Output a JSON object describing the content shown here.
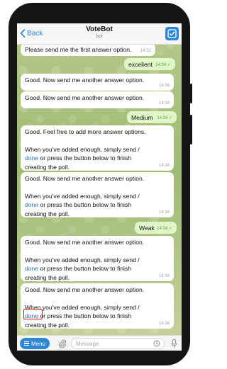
{
  "header": {
    "back_label": "Back",
    "title": "VoteBot",
    "subtitle": "bot"
  },
  "messages": [
    {
      "id": "m1",
      "direction": "in",
      "text": "Please send me the first answer option.",
      "time": "14:33"
    },
    {
      "id": "m2",
      "direction": "out",
      "text": "excellent",
      "time": "14:34"
    },
    {
      "id": "m3",
      "direction": "in",
      "text": "Good. Now send me another answer option.",
      "time": "14:34"
    },
    {
      "id": "m4",
      "direction": "in",
      "text": "Good. Now send me another answer option.",
      "time": "14:34"
    },
    {
      "id": "m5",
      "direction": "out",
      "text": "Medium",
      "time": "14:34"
    },
    {
      "id": "m6",
      "direction": "in",
      "line1": "Good. Feel free to add more answer options.",
      "line2": "When you've added enough, simply send /",
      "link": "done",
      "line3_rest": " or press the button below to finish",
      "line4": "creating the poll.",
      "time": "14:34"
    },
    {
      "id": "m7",
      "direction": "in",
      "line1": "Good. Now send me another answer option.",
      "line2": "When you've added enough, simply send /",
      "link": "done",
      "line3_rest": " or press the button below to finish",
      "line4": "creating the poll.",
      "time": "14:34"
    },
    {
      "id": "m8",
      "direction": "out",
      "text": "Weak",
      "time": "14:34"
    },
    {
      "id": "m9",
      "direction": "in",
      "line1": "Good. Now send me another answer option.",
      "line2": "When you've added enough, simply send /",
      "link": "done",
      "line3_rest": " or press the button below to finish",
      "line4": "creating the poll.",
      "time": "14:34"
    },
    {
      "id": "m10",
      "direction": "in",
      "line1": "Good. Now send me another answer option.",
      "line2": "When you've added enough, simply send /",
      "link": "done",
      "line3_rest": " or press the button below to finish",
      "line4": "creating the poll.",
      "time": "14:34"
    }
  ],
  "inputbar": {
    "menu_label": "Menu",
    "message_placeholder": "Message"
  },
  "colors": {
    "accent": "#2f86d9",
    "outgoing_bubble": "#e0f6c9",
    "highlight": "#e01818"
  },
  "icons": [
    "chevron-left-icon",
    "checkbox-icon",
    "menu-icon",
    "paperclip-icon",
    "timer-icon",
    "microphone-icon",
    "double-check-icon"
  ]
}
